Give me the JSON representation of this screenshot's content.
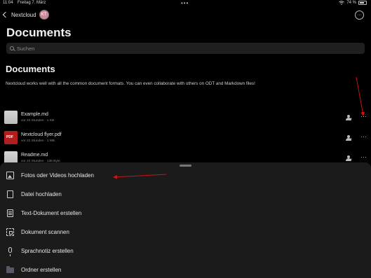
{
  "status_bar": {
    "time": "11:04",
    "date": "Freitag 7. März",
    "multitasking_dots": "•••",
    "battery_text": "74 %",
    "battery_level": 0.74
  },
  "nav": {
    "back_label": "Nextcloud",
    "avatar_initials": "KT",
    "more_label": "···"
  },
  "page": {
    "title": "Documents"
  },
  "search": {
    "placeholder": "Suchen"
  },
  "section": {
    "title": "Documents",
    "description": "Nextcloud works well with all the common document formats. You can even collaborate with others on ODT and Markdown files!"
  },
  "files": [
    {
      "name": "Example.md",
      "meta": "vor 22 Stunden · 1 KB",
      "type": "md"
    },
    {
      "name": "Nextcloud flyer.pdf",
      "meta": "vor 22 Stunden · 1 MB",
      "type": "pdf"
    },
    {
      "name": "Readme.md",
      "meta": "vor 22 Stunden · 136 Byte",
      "type": "md"
    }
  ],
  "row_more_label": "···",
  "sheet": {
    "items": [
      {
        "label": "Fotos oder Videos hochladen",
        "icon": "photo-icon"
      },
      {
        "label": "Datei hochladen",
        "icon": "file-icon"
      },
      {
        "label": "Text-Dokument erstellen",
        "icon": "document-icon"
      },
      {
        "label": "Dokument scannen",
        "icon": "scan-icon"
      },
      {
        "label": "Sprachnotiz erstellen",
        "icon": "microphone-icon"
      },
      {
        "label": "Ordner erstellen",
        "icon": "folder-icon"
      }
    ]
  },
  "colors": {
    "background": "#000000",
    "sheet_background": "#1b1b1b",
    "annotation_arrow": "#c81414",
    "pdf_icon": "#b21d1d",
    "avatar": "#c98a9a"
  }
}
